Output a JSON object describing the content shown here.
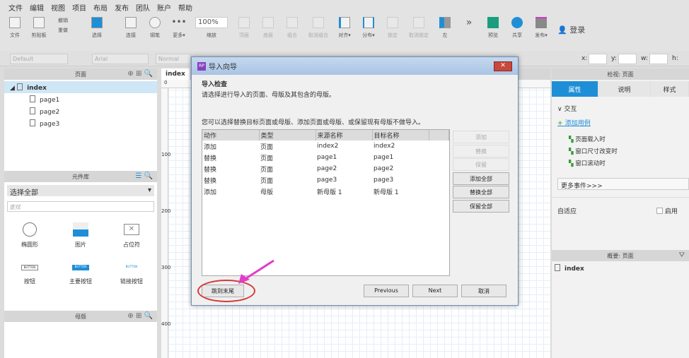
{
  "menu": [
    "文件",
    "编辑",
    "视图",
    "项目",
    "布局",
    "发布",
    "团队",
    "账户",
    "帮助"
  ],
  "toolbar": {
    "file": "文件",
    "clipboard": "剪贴板",
    "undo": "撤销",
    "redo": "重做",
    "select": "选择",
    "connect": "连接",
    "pen": "钢笔",
    "more": "更多▾",
    "zoom_value": "100%",
    "zoom": "缩放",
    "top": "顶层",
    "bottom": "底层",
    "group": "组合",
    "ungroup": "取消组合",
    "align": "对齐▾",
    "distribute": "分布▾",
    "lock": "锁定",
    "unlock": "取消锁定",
    "left": "左",
    "preview": "预览",
    "share": "共享",
    "publish": "发布▾",
    "login": "登录"
  },
  "stylebar": {
    "style": "Default",
    "font": "Arial",
    "weight": "Normal",
    "x": "x:",
    "y": "y:",
    "w": "w:",
    "h": "h:"
  },
  "pages": {
    "title": "页面",
    "root": "index",
    "children": [
      "page1",
      "page2",
      "page3"
    ]
  },
  "library": {
    "title": "元件库",
    "select": "选择全部",
    "search_placeholder": "查找",
    "widgets": [
      {
        "label": "椭圆形"
      },
      {
        "label": "图片"
      },
      {
        "label": "占位符"
      },
      {
        "label": "按钮",
        "icon_text": "BUTTON"
      },
      {
        "label": "主要按钮",
        "icon_text": "BUTTON"
      },
      {
        "label": "链接按钮",
        "icon_text": "BUTTON"
      }
    ]
  },
  "masters": {
    "title": "母版"
  },
  "canvas": {
    "tab": "index",
    "ruler": [
      "0",
      "100",
      "200",
      "300",
      "400"
    ]
  },
  "inspector": {
    "title": "检视: 页面",
    "tabs": [
      "属性",
      "说明",
      "样式"
    ],
    "section": "交互",
    "add_case": "添加用例",
    "events": [
      "页面载入时",
      "窗口尺寸改变时",
      "窗口滚动时"
    ],
    "more_events": "更多事件>>>",
    "adaptive": "自适应",
    "enable": "启用"
  },
  "outline": {
    "title": "概要: 页面",
    "item": "index"
  },
  "dialog": {
    "title": "导入向导",
    "heading": "导入检查",
    "desc": "请选择进行导入的页面、母版及其包含的母版。",
    "desc2": "您可以选择替换目标页面或母版、添加页面或母版、或保留现有母版不做导入。",
    "columns": [
      "动作",
      "类型",
      "来源名称",
      "目标名称"
    ],
    "rows": [
      [
        "添加",
        "页面",
        "index2",
        "index2"
      ],
      [
        "替换",
        "页面",
        "page1",
        "page1"
      ],
      [
        "替换",
        "页面",
        "page2",
        "page2"
      ],
      [
        "替换",
        "页面",
        "page3",
        "page3"
      ],
      [
        "添加",
        "母版",
        "新母版 1",
        "新母版 1"
      ]
    ],
    "side_buttons": [
      "添加",
      "替换",
      "保留",
      "添加全部",
      "替换全部",
      "保留全部"
    ],
    "jump": "跳到末尾",
    "previous": "Previous",
    "next": "Next",
    "cancel": "取消"
  },
  "colors": {
    "accent": "#1e8fd6",
    "annotation": "#e23cc8",
    "circle": "#d33a3a"
  }
}
